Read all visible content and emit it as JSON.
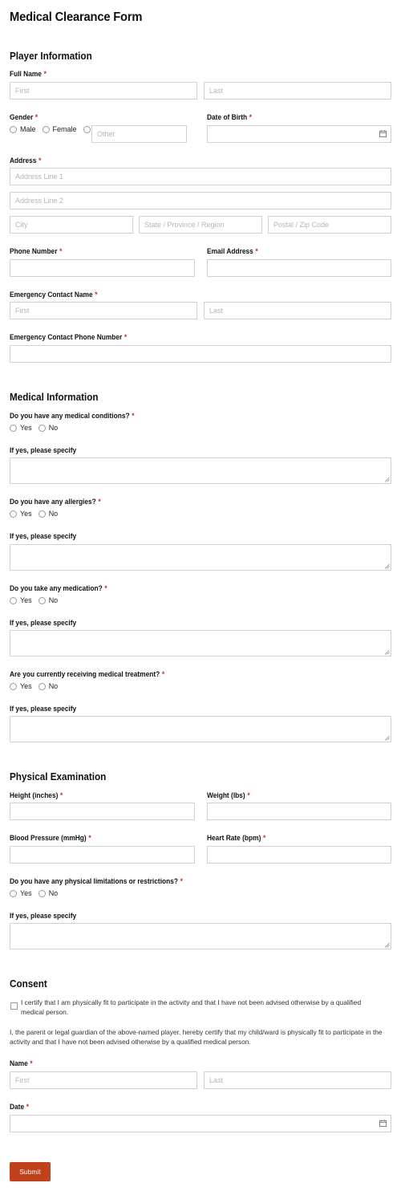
{
  "form": {
    "title": "Medical Clearance Form",
    "submit_label": "Submit"
  },
  "player": {
    "section_title": "Player Information",
    "full_name_label": "Full Name",
    "first_placeholder": "First",
    "last_placeholder": "Last",
    "gender_label": "Gender",
    "gender_options": [
      "Male",
      "Female"
    ],
    "gender_other_placeholder": "Other",
    "dob_label": "Date of Birth",
    "address_label": "Address",
    "address1_placeholder": "Address Line 1",
    "address2_placeholder": "Address Line 2",
    "city_placeholder": "City",
    "state_placeholder": "State / Province / Region",
    "zip_placeholder": "Postal / Zip Code",
    "phone_label": "Phone Number",
    "email_label": "Email Address",
    "emergency_name_label": "Emergency Contact Name",
    "emergency_phone_label": "Emergency Contact Phone Number"
  },
  "medical": {
    "section_title": "Medical Information",
    "yes": "Yes",
    "no": "No",
    "specify_label": "If yes, please specify",
    "q1": "Do you have any medical conditions?",
    "q2": "Do you have any allergies?",
    "q3": "Do you take any medication?",
    "q4": "Are you currently receiving medical treatment?"
  },
  "physical": {
    "section_title": "Physical Examination",
    "height_label": "Height (inches)",
    "weight_label": "Weight (lbs)",
    "bp_label": "Blood Pressure (mmHg)",
    "hr_label": "Heart Rate (bpm)",
    "limitations_label": "Do you have any physical limitations or restrictions?",
    "yes": "Yes",
    "no": "No",
    "specify_label": "If yes, please specify"
  },
  "consent": {
    "section_title": "Consent",
    "checkbox_text": "I certify that I am physically fit to participate in the activity and that I have not been advised otherwise by a qualified medical person.",
    "guardian_text": "I, the parent or legal guardian of the above-named player, hereby certify that my child/ward is physically fit to participate in the activity and that I have not been advised otherwise by a qualified medical person.",
    "name_label": "Name",
    "first_placeholder": "First",
    "last_placeholder": "Last",
    "date_label": "Date"
  },
  "ui": {
    "required_mark": "*",
    "accent_color": "#c0411b",
    "calendar_icon": "calendar-icon"
  }
}
